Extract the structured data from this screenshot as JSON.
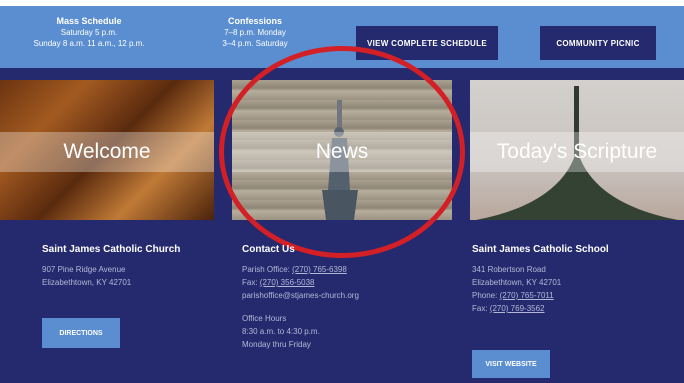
{
  "schedule": {
    "mass": {
      "heading": "Mass Schedule",
      "lines": [
        "Saturday 5 p.m.",
        "Sunday 8 a.m. 11 a.m., 12 p.m."
      ]
    },
    "confessions": {
      "heading": "Confessions",
      "lines": [
        "7–8 p.m. Monday",
        "3–4 p.m. Saturday"
      ]
    }
  },
  "buttons": {
    "schedule": "VIEW COMPLETE SCHEDULE",
    "picnic": "COMMUNITY PICNIC",
    "directions": "DIRECTIONS",
    "website": "VISIT WEBSITE"
  },
  "tiles": {
    "welcome": "Welcome",
    "news": "News",
    "scripture": "Today's Scripture"
  },
  "church": {
    "title": "Saint James Catholic Church",
    "lines": [
      "907 Pine Ridge Avenue",
      "Elizabethtown, KY 42701"
    ]
  },
  "contact": {
    "title": "Contact Us",
    "office_label": "Parish Office: ",
    "office_phone": "(270) 765-6398",
    "fax_label": "Fax: ",
    "fax": "(270) 356-5038",
    "email": "parishoffice@stjames-church.org",
    "hours_heading": "Office Hours",
    "hours": [
      "8:30 a.m. to 4:30 p.m.",
      "Monday thru Friday"
    ]
  },
  "school": {
    "title": "Saint James Catholic School",
    "lines": [
      "341 Robertson Road",
      "Elizabethtown, KY 42701"
    ],
    "phone_label": "Phone: ",
    "phone": "(270) 765-7011",
    "fax_label": "Fax: ",
    "fax": "(270) 769-3562"
  },
  "colors": {
    "navy": "#252a6e",
    "blue": "#5a8ed0",
    "highlight": "#d31f26"
  }
}
